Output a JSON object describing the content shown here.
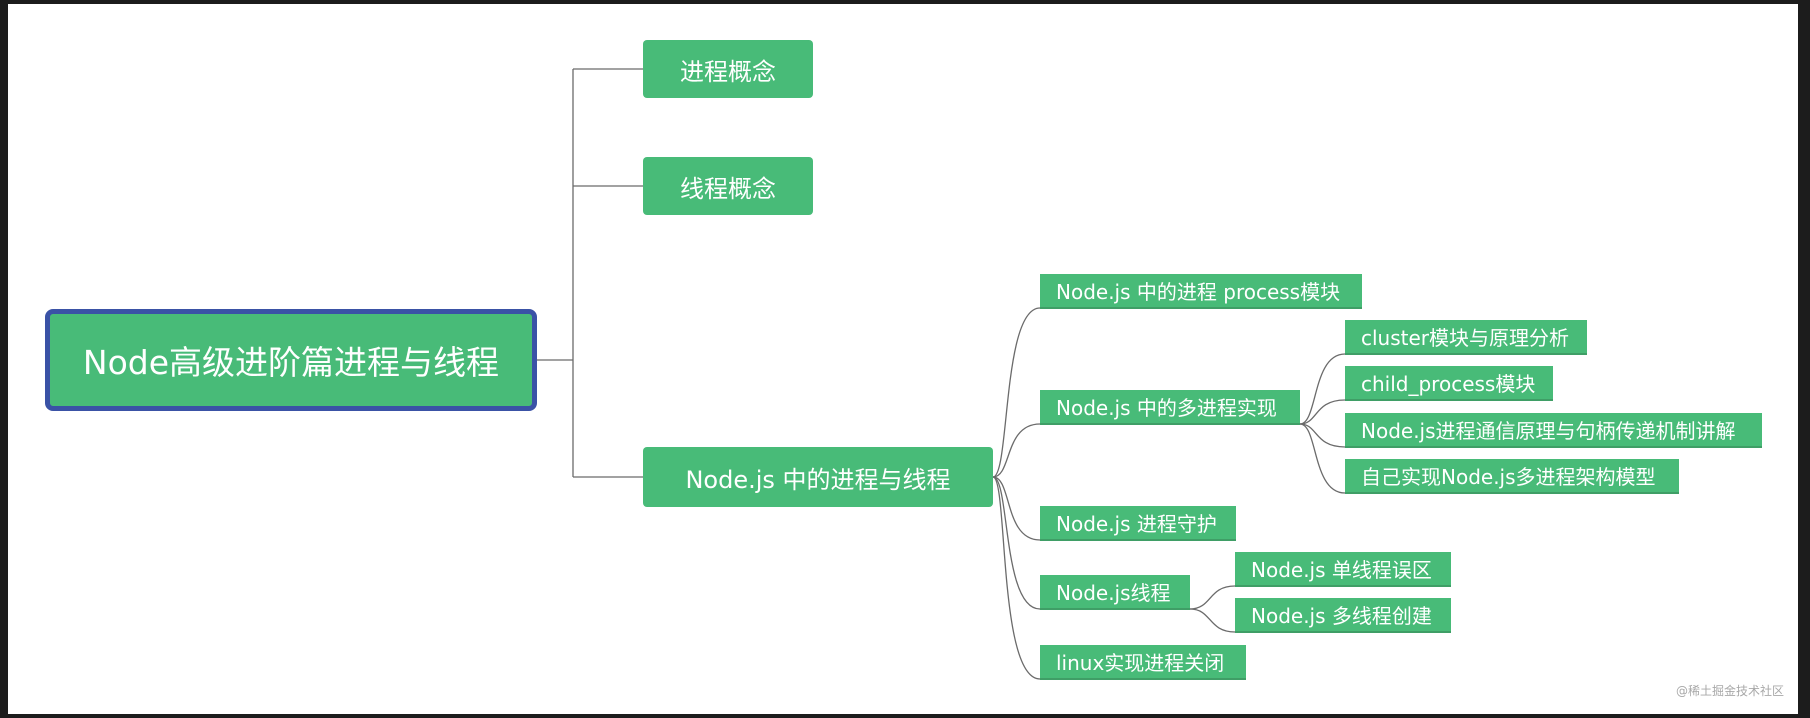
{
  "title": "Node高级进阶篇进程与线程",
  "branches": [
    {
      "label": "进程概念"
    },
    {
      "label": "线程概念"
    },
    {
      "label": "Node.js 中的进程与线程",
      "children": [
        {
          "label": "Node.js 中的进程 process模块"
        },
        {
          "label": "Node.js 中的多进程实现",
          "children": [
            {
              "label": "cluster模块与原理分析"
            },
            {
              "label": "child_process模块"
            },
            {
              "label": "Node.js进程通信原理与句柄传递机制讲解"
            },
            {
              "label": "自己实现Node.js多进程架构模型"
            }
          ]
        },
        {
          "label": "Node.js 进程守护"
        },
        {
          "label": "Node.js线程",
          "children": [
            {
              "label": "Node.js 单线程误区"
            },
            {
              "label": "Node.js 多线程创建"
            }
          ]
        },
        {
          "label": "linux实现进程关闭"
        }
      ]
    }
  ],
  "watermark": "@稀土掘金技术社区",
  "colors": {
    "node_fill": "#48bb78",
    "root_border": "#3a52a6",
    "connector": "#6b6b6b",
    "background": "#ffffff",
    "frame": "#1c1c1c"
  }
}
